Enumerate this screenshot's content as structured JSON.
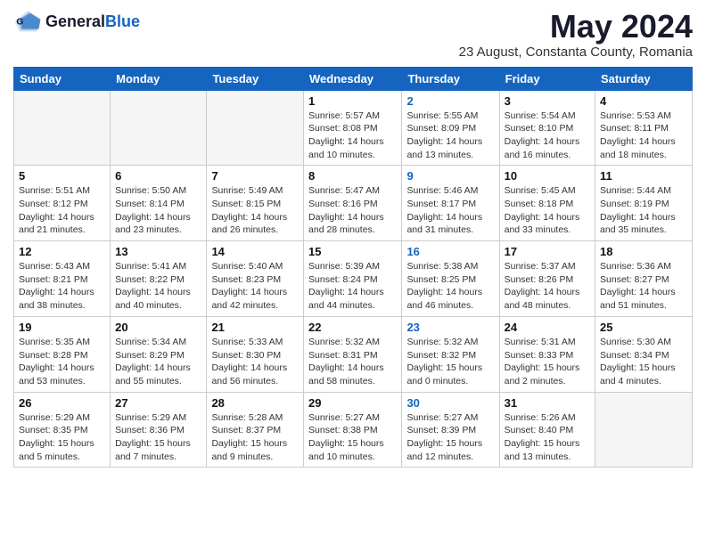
{
  "header": {
    "logo_general": "General",
    "logo_blue": "Blue",
    "month": "May 2024",
    "subtitle": "23 August, Constanta County, Romania"
  },
  "days_of_week": [
    "Sunday",
    "Monday",
    "Tuesday",
    "Wednesday",
    "Thursday",
    "Friday",
    "Saturday"
  ],
  "weeks": [
    {
      "days": [
        {
          "num": "",
          "content": ""
        },
        {
          "num": "",
          "content": ""
        },
        {
          "num": "",
          "content": ""
        },
        {
          "num": "1",
          "content": "Sunrise: 5:57 AM\nSunset: 8:08 PM\nDaylight: 14 hours\nand 10 minutes."
        },
        {
          "num": "2",
          "content": "Sunrise: 5:55 AM\nSunset: 8:09 PM\nDaylight: 14 hours\nand 13 minutes.",
          "thursday": true
        },
        {
          "num": "3",
          "content": "Sunrise: 5:54 AM\nSunset: 8:10 PM\nDaylight: 14 hours\nand 16 minutes."
        },
        {
          "num": "4",
          "content": "Sunrise: 5:53 AM\nSunset: 8:11 PM\nDaylight: 14 hours\nand 18 minutes."
        }
      ]
    },
    {
      "days": [
        {
          "num": "5",
          "content": "Sunrise: 5:51 AM\nSunset: 8:12 PM\nDaylight: 14 hours\nand 21 minutes."
        },
        {
          "num": "6",
          "content": "Sunrise: 5:50 AM\nSunset: 8:14 PM\nDaylight: 14 hours\nand 23 minutes."
        },
        {
          "num": "7",
          "content": "Sunrise: 5:49 AM\nSunset: 8:15 PM\nDaylight: 14 hours\nand 26 minutes."
        },
        {
          "num": "8",
          "content": "Sunrise: 5:47 AM\nSunset: 8:16 PM\nDaylight: 14 hours\nand 28 minutes."
        },
        {
          "num": "9",
          "content": "Sunrise: 5:46 AM\nSunset: 8:17 PM\nDaylight: 14 hours\nand 31 minutes.",
          "thursday": true
        },
        {
          "num": "10",
          "content": "Sunrise: 5:45 AM\nSunset: 8:18 PM\nDaylight: 14 hours\nand 33 minutes."
        },
        {
          "num": "11",
          "content": "Sunrise: 5:44 AM\nSunset: 8:19 PM\nDaylight: 14 hours\nand 35 minutes."
        }
      ]
    },
    {
      "days": [
        {
          "num": "12",
          "content": "Sunrise: 5:43 AM\nSunset: 8:21 PM\nDaylight: 14 hours\nand 38 minutes."
        },
        {
          "num": "13",
          "content": "Sunrise: 5:41 AM\nSunset: 8:22 PM\nDaylight: 14 hours\nand 40 minutes."
        },
        {
          "num": "14",
          "content": "Sunrise: 5:40 AM\nSunset: 8:23 PM\nDaylight: 14 hours\nand 42 minutes."
        },
        {
          "num": "15",
          "content": "Sunrise: 5:39 AM\nSunset: 8:24 PM\nDaylight: 14 hours\nand 44 minutes."
        },
        {
          "num": "16",
          "content": "Sunrise: 5:38 AM\nSunset: 8:25 PM\nDaylight: 14 hours\nand 46 minutes.",
          "thursday": true
        },
        {
          "num": "17",
          "content": "Sunrise: 5:37 AM\nSunset: 8:26 PM\nDaylight: 14 hours\nand 48 minutes."
        },
        {
          "num": "18",
          "content": "Sunrise: 5:36 AM\nSunset: 8:27 PM\nDaylight: 14 hours\nand 51 minutes."
        }
      ]
    },
    {
      "days": [
        {
          "num": "19",
          "content": "Sunrise: 5:35 AM\nSunset: 8:28 PM\nDaylight: 14 hours\nand 53 minutes."
        },
        {
          "num": "20",
          "content": "Sunrise: 5:34 AM\nSunset: 8:29 PM\nDaylight: 14 hours\nand 55 minutes."
        },
        {
          "num": "21",
          "content": "Sunrise: 5:33 AM\nSunset: 8:30 PM\nDaylight: 14 hours\nand 56 minutes."
        },
        {
          "num": "22",
          "content": "Sunrise: 5:32 AM\nSunset: 8:31 PM\nDaylight: 14 hours\nand 58 minutes."
        },
        {
          "num": "23",
          "content": "Sunrise: 5:32 AM\nSunset: 8:32 PM\nDaylight: 15 hours\nand 0 minutes.",
          "thursday": true
        },
        {
          "num": "24",
          "content": "Sunrise: 5:31 AM\nSunset: 8:33 PM\nDaylight: 15 hours\nand 2 minutes."
        },
        {
          "num": "25",
          "content": "Sunrise: 5:30 AM\nSunset: 8:34 PM\nDaylight: 15 hours\nand 4 minutes."
        }
      ]
    },
    {
      "days": [
        {
          "num": "26",
          "content": "Sunrise: 5:29 AM\nSunset: 8:35 PM\nDaylight: 15 hours\nand 5 minutes."
        },
        {
          "num": "27",
          "content": "Sunrise: 5:29 AM\nSunset: 8:36 PM\nDaylight: 15 hours\nand 7 minutes."
        },
        {
          "num": "28",
          "content": "Sunrise: 5:28 AM\nSunset: 8:37 PM\nDaylight: 15 hours\nand 9 minutes."
        },
        {
          "num": "29",
          "content": "Sunrise: 5:27 AM\nSunset: 8:38 PM\nDaylight: 15 hours\nand 10 minutes."
        },
        {
          "num": "30",
          "content": "Sunrise: 5:27 AM\nSunset: 8:39 PM\nDaylight: 15 hours\nand 12 minutes.",
          "thursday": true
        },
        {
          "num": "31",
          "content": "Sunrise: 5:26 AM\nSunset: 8:40 PM\nDaylight: 15 hours\nand 13 minutes."
        },
        {
          "num": "",
          "content": ""
        }
      ]
    }
  ]
}
